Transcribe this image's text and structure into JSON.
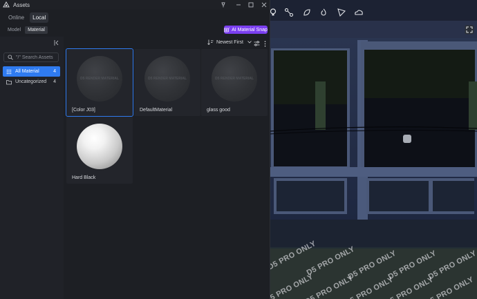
{
  "window": {
    "title": "Assets"
  },
  "source_tabs": [
    {
      "label": "Online"
    },
    {
      "label": "Local"
    }
  ],
  "type_tabs": [
    {
      "label": "Model"
    },
    {
      "label": "Material"
    }
  ],
  "ai_button": {
    "label": "AI Material Snap",
    "color": "#7b3ff0"
  },
  "search": {
    "placeholder": "\"/\" Search Assets"
  },
  "categories": [
    {
      "label": "All Material",
      "count": "4"
    },
    {
      "label": "Uncategorized",
      "count": "4"
    }
  ],
  "sort": {
    "label": "Newest First"
  },
  "materials": [
    {
      "name": "[Color J03]",
      "thumb_text": "D5 RENDER MATERIAL",
      "selected": true
    },
    {
      "name": "DefaultMaterial",
      "thumb_text": "D5 RENDER MATERIAL"
    },
    {
      "name": "glass good",
      "thumb_text": "D5 RENDER MATERIAL"
    },
    {
      "name": "Hard Black"
    }
  ],
  "watermark": {
    "text": "D5 PRO ONLY"
  },
  "accent": "#2f7bf0"
}
